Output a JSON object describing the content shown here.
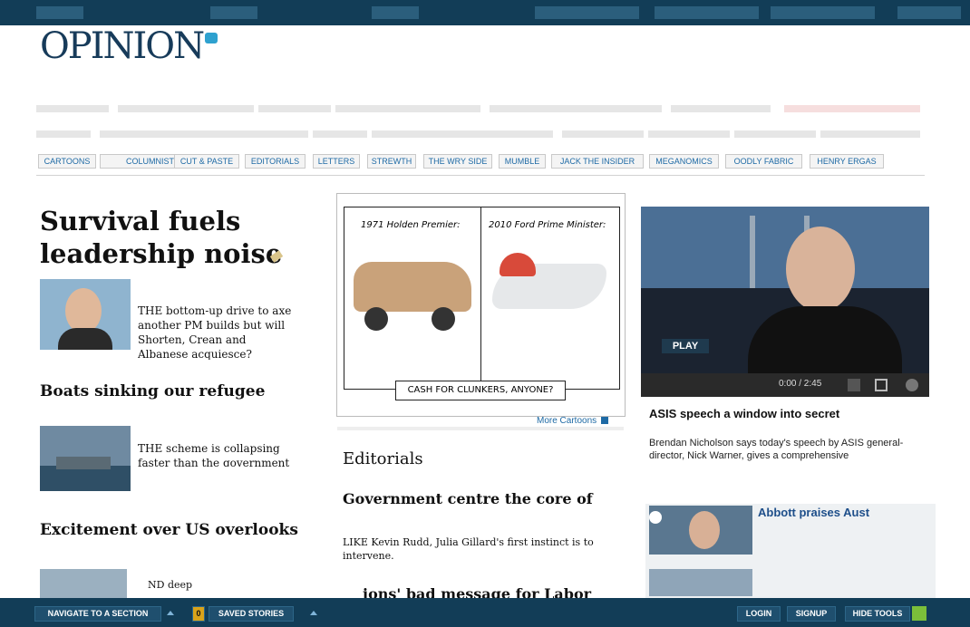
{
  "header": {
    "logo_text": "OPINION"
  },
  "subnav": [
    "CARTOONS",
    "COLUMNISTS",
    "CUT & PASTE",
    "EDITORIALS",
    "LETTERS",
    "STREWTH",
    "THE WRY SIDE",
    "MUMBLE",
    "JACK THE INSIDER",
    "MEGANOMICS",
    "OODLY FABRIC",
    "HENRY ERGAS"
  ],
  "left": {
    "lead_title": "Survival fuels leadership noise",
    "lead_summary": "THE bottom-up drive to axe another PM builds but will Shorten, Crean and Albanese acquiesce?",
    "story2_title": "Boats sinking our refugee",
    "story2_summary": "THE scheme is collapsing faster than the government can respond",
    "story3_title": "Excitement over US overlooks",
    "story4_summary": "ND deep"
  },
  "middle": {
    "panel_left_caption": "1971 Holden Premier:",
    "panel_right_caption": "2010 Ford Prime Minister:",
    "cartoon_caption": "CASH FOR CLUNKERS, ANYONE?",
    "more_cartoons": "More Cartoons",
    "section_title": "Editorials",
    "editorial1_title": "Government centre the core of",
    "editorial1_summary": "LIKE Kevin Rudd, Julia Gillard's first instinct is to intervene.",
    "editorial2_title": "ions' bad message for Labor"
  },
  "right": {
    "play_label": "PLAY",
    "video_time": "0:00 / 2:45",
    "video_title": "ASIS speech a window into secret",
    "video_summary": "Brendan Nicholson says today's speech by ASIS general-director, Nick Warner, gives a comprehensive",
    "story_title": "Abbott praises Aust"
  },
  "bottom": {
    "navigate": "NAVIGATE TO A SECTION",
    "saved_count": "0",
    "saved": "SAVED STORIES",
    "login": "LOGIN",
    "signup": "SIGNUP",
    "hide_tools": "HIDE TOOLS"
  },
  "colors": {
    "topbar": "#123d57",
    "link": "#1e6aa5"
  }
}
